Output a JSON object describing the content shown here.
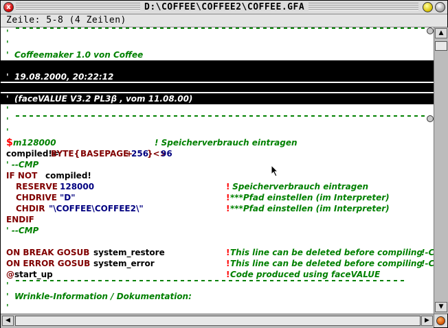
{
  "window": {
    "title": "D:\\COFFEE\\COFFEE2\\COFFEE.GFA",
    "close_glyph": "x"
  },
  "infobar": {
    "text": "Zeile: 5-8 (4 Zeilen)"
  },
  "code": {
    "l01_quote": "'",
    "l02_quote": "'",
    "l03_text": "'  Coffeemaker 1.0 von Coffee",
    "l05_text": "'  19.08.2000, 20:22:12",
    "l07_quote": "'",
    "l08_text": "'  (faceVALUE V3.2 PL3β , vom 11.08.00)",
    "l09_quote": "'",
    "l10_quote": "'",
    "l12_dollar": "$",
    "l12_cmd": "m128000",
    "l12_comment": "! Speicherverbrauch eintragen",
    "l13_a": "compiled!=",
    "l13_b": "BYTE{",
    "l13_c": "BASEPAGE",
    "l13_d": "+",
    "l13_e": "256",
    "l13_f": "}<>",
    "l13_g": "96",
    "l14_text": "' --CMP",
    "l15_if": "IF NOT",
    "l15_var": "compiled!",
    "l16_kw": "RESERVE",
    "l16_num": "128000",
    "l16_bang": "!",
    "l16_comment": " Speicherverbrauch eintragen",
    "l17_kw": "CHDRIVE",
    "l17_str": "\"D\"",
    "l17_bang": "!",
    "l17_comment": "***Pfad einstellen (im Interpreter)",
    "l18_kw": "CHDIR",
    "l18_str": "\"\\COFFEE\\COFFEE2\\\"",
    "l18_bang": "!",
    "l18_comment": "***Pfad einstellen (im Interpreter)",
    "l19_kw": "ENDIF",
    "l20_text": "' --CMP",
    "l22_kw": "ON BREAK GOSUB",
    "l22_proc": "system_restore",
    "l22_bang": "!",
    "l22_comment": "This line can be deleted before compiling",
    "l22_tail": "!-C",
    "l23_kw": "ON ERROR GOSUB",
    "l23_proc": "system_error",
    "l23_bang": "!",
    "l23_comment": "This line can be deleted before compiling",
    "l23_tail": "!-C",
    "l24_at": "@",
    "l24_proc": "start_up",
    "l24_bang": "!",
    "l24_comment": "Code produced using faceVALUE",
    "l25_quote": "'",
    "l26_text": "'  Wrinkle-Information / Dokumentation:",
    "l27_quote": "'"
  },
  "scrollbars": {
    "up_arrow": "▲",
    "down_arrow": "▼",
    "left_arrow": "◀",
    "right_arrow": "▶"
  },
  "colors": {
    "comment": "#008000",
    "keyword": "#800000",
    "number": "#000080",
    "highlight": "#000000"
  }
}
